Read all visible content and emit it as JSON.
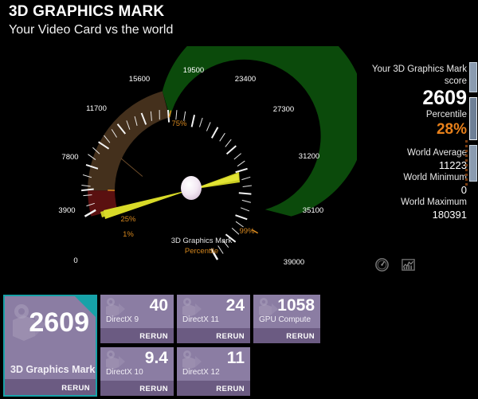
{
  "header": {
    "title": "3D GRAPHICS MARK",
    "subtitle": "Your Video Card vs the world"
  },
  "gauge": {
    "caption_main": "3D Graphics Mark",
    "caption_sub": "Percentile",
    "tick_labels": [
      "0",
      "3900",
      "7800",
      "11700",
      "15600",
      "19500",
      "23400",
      "27300",
      "31200",
      "35100",
      "39000"
    ],
    "percentile_markers": [
      {
        "label": "1%",
        "value": 390
      },
      {
        "label": "25%",
        "value": 2850
      },
      {
        "label": "75%",
        "value": 16500
      },
      {
        "label": "99%",
        "value": 36400
      }
    ],
    "needle_value": 2609,
    "min": 0,
    "max": 39000,
    "colors": {
      "red_band": "#5a1010",
      "brown_band": "#44301c",
      "green_band": "#0b4a0b",
      "needle": "#d8da28",
      "hub": "#f0e4f0",
      "marker_text": "#d4861e",
      "tick": "#f2f2f2"
    }
  },
  "gauge_icons": [
    {
      "name": "speedometer-icon"
    },
    {
      "name": "chart-icon"
    }
  ],
  "stats": {
    "score_label": "Your 3D Graphics Mark score",
    "score_value": "2609",
    "percentile_label": "Percentile",
    "percentile_value": "28%",
    "world_average_label": "World Average",
    "world_average_value": "11223",
    "world_minimum_label": "World Minimum",
    "world_minimum_value": "0",
    "world_maximum_label": "World Maximum",
    "world_maximum_value": "180391"
  },
  "tiles": {
    "rerun_label": "RERUN",
    "main": {
      "score": "2609",
      "name": "3D Graphics Mark"
    },
    "items": [
      {
        "score": "40",
        "name": "DirectX 9"
      },
      {
        "score": "9.4",
        "name": "DirectX 10"
      },
      {
        "score": "24",
        "name": "DirectX 11"
      },
      {
        "score": "11",
        "name": "DirectX 12"
      },
      {
        "score": "1058",
        "name": "GPU Compute"
      }
    ]
  },
  "chart_data": {
    "type": "gauge",
    "title": "3D Graphics Mark Percentile",
    "min": 0,
    "max": 39000,
    "tick_step": 3900,
    "tick_labels": [
      "0",
      "3900",
      "7800",
      "11700",
      "15600",
      "19500",
      "23400",
      "27300",
      "31200",
      "35100",
      "39000"
    ],
    "value": 2609,
    "percentile": 28,
    "bands": [
      {
        "from": 0,
        "to": 2850,
        "color": "#5a1010",
        "name": "low"
      },
      {
        "from": 2850,
        "to": 16500,
        "color": "#44301c",
        "name": "mid"
      },
      {
        "from": 16500,
        "to": 39000,
        "color": "#0b4a0b",
        "name": "high"
      }
    ],
    "annotations": [
      {
        "label": "1%",
        "value": 390
      },
      {
        "label": "25%",
        "value": 2850
      },
      {
        "label": "75%",
        "value": 16500
      },
      {
        "label": "99%",
        "value": 36400
      }
    ],
    "reference_values": {
      "score": 2609,
      "world_average": 11223,
      "world_minimum": 0,
      "world_maximum": 180391
    },
    "sub_scores": {
      "categories": [
        "DirectX 9",
        "DirectX 10",
        "DirectX 11",
        "DirectX 12",
        "GPU Compute"
      ],
      "values": [
        40,
        9.4,
        24,
        11,
        1058
      ]
    }
  }
}
